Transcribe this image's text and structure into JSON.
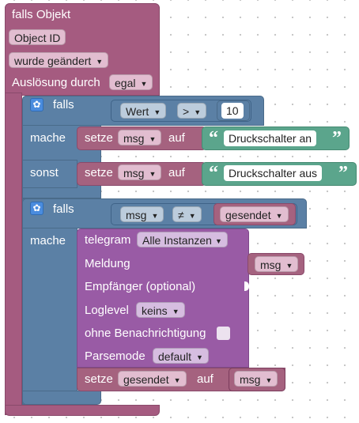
{
  "trigger": {
    "title": "falls Objekt",
    "object_id": "Object ID",
    "changed": "wurde geändert",
    "trigger_label": "Auslösung durch",
    "trigger_value": "egal"
  },
  "if1": {
    "if_label": "falls",
    "cond_left": "Wert",
    "cond_op": ">",
    "cond_right": "10",
    "do_label": "mache",
    "do_set": "setze",
    "do_var": "msg",
    "do_on": "auf",
    "do_text": "Druckschalter an",
    "else_label": "sonst",
    "else_set": "setze",
    "else_var": "msg",
    "else_on": "auf",
    "else_text": "Druckschalter aus"
  },
  "if2": {
    "if_label": "falls",
    "cond_left": "msg",
    "cond_op": "≠",
    "cond_right": "gesendet",
    "do_label": "mache"
  },
  "telegram": {
    "label": "telegram",
    "instance": "Alle Instanzen",
    "message_label": "Meldung",
    "message_value": "msg",
    "recipient_label": "Empfänger (optional)",
    "loglevel_label": "Loglevel",
    "loglevel_value": "keins",
    "silent_label": "ohne Benachrichtigung",
    "parsemode_label": "Parsemode",
    "parsemode_value": "default"
  },
  "set_sent": {
    "set": "setze",
    "var": "gesendet",
    "on": "auf",
    "value": "msg"
  },
  "colors": {
    "event_block": "#a55b80",
    "logic_block": "#5b80a5",
    "telegram_block": "#995ba5",
    "text_block": "#5ba58c",
    "gear_button": "#4a8cde"
  },
  "icons": {
    "dropdown": "▼",
    "settings": "✿",
    "quote_open": "“",
    "quote_close": "”"
  }
}
